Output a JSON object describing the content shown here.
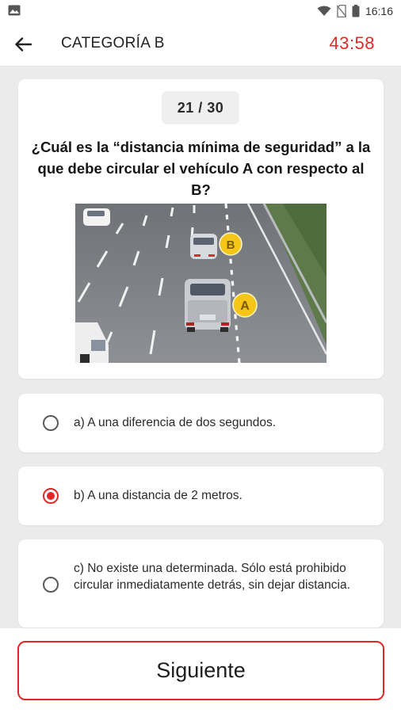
{
  "status_bar": {
    "time": "16:16"
  },
  "app_bar": {
    "title": "CATEGORÍA B",
    "timer": "43:58"
  },
  "question": {
    "counter": "21 / 30",
    "text": "¿Cuál es la “distancia mínima de seguridad” a la que debe circular el vehículo A con respecto al B?",
    "image_markers": [
      "B",
      "A"
    ]
  },
  "options": [
    {
      "label": "a) A una diferencia de dos segundos.",
      "selected": false
    },
    {
      "label": "b) A una distancia de 2 metros.",
      "selected": true
    },
    {
      "label": "c) No existe una determinada. Sólo está prohibido circular inmediatamente detrás, sin dejar distancia.",
      "selected": false
    }
  ],
  "next_button": {
    "label": "Siguiente"
  },
  "colors": {
    "accent": "#e02727",
    "timer": "#e22a2a",
    "background": "#ebebeb",
    "marker": "#f5c518"
  }
}
